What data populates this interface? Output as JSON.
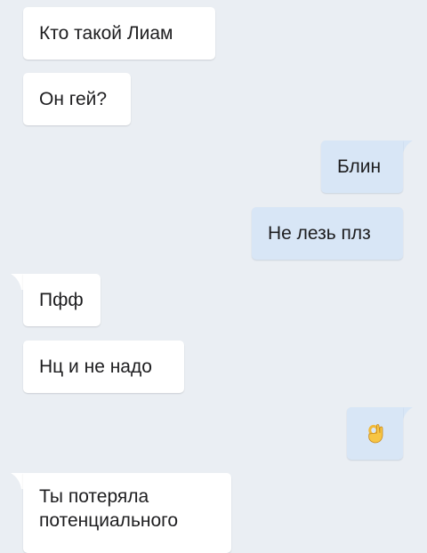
{
  "chat": {
    "messages": [
      {
        "side": "incoming",
        "text": "Кто такой Лиам"
      },
      {
        "side": "incoming",
        "text": "Он гей?"
      },
      {
        "side": "outgoing",
        "text": "Блин"
      },
      {
        "side": "outgoing",
        "text": "Не лезь плз"
      },
      {
        "side": "incoming",
        "text": "Пфф"
      },
      {
        "side": "incoming",
        "text": "Нц и не надо"
      },
      {
        "side": "outgoing",
        "text": "ok-hand-emoji"
      },
      {
        "side": "incoming",
        "text": "Ты потеряла потенциального"
      }
    ]
  },
  "colors": {
    "background": "#eaeef3",
    "incoming_bubble": "#ffffff",
    "outgoing_bubble": "#d8e6f6",
    "text": "#1d1d1f"
  }
}
